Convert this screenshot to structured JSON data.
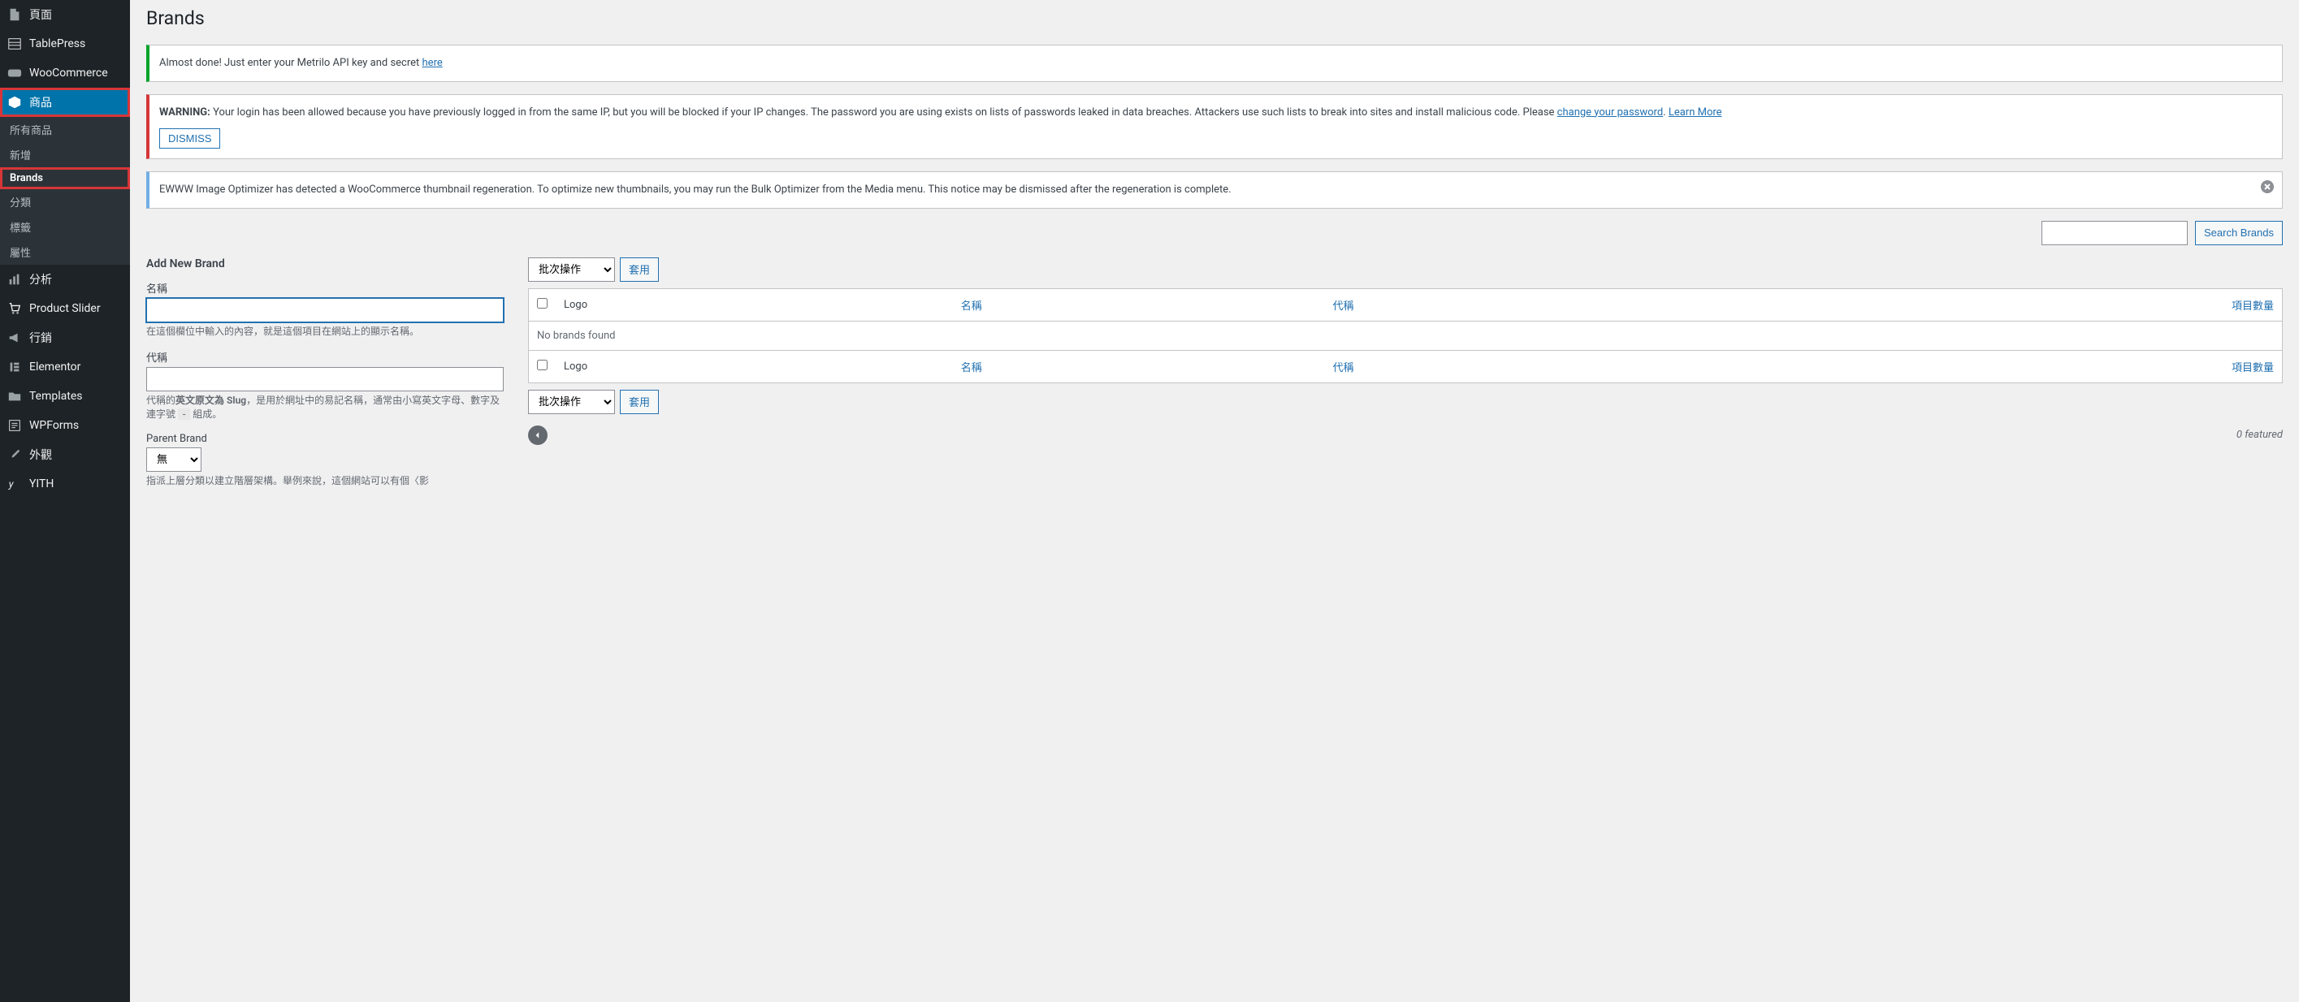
{
  "sidebar": {
    "items": [
      {
        "label": "頁面",
        "icon": "page"
      },
      {
        "label": "TablePress",
        "icon": "table"
      },
      {
        "label": "WooCommerce",
        "icon": "woo"
      },
      {
        "label": "商品",
        "icon": "cube",
        "current": true
      },
      {
        "label": "分析",
        "icon": "chart"
      },
      {
        "label": "Product Slider",
        "icon": "cart"
      },
      {
        "label": "行銷",
        "icon": "megaphone"
      },
      {
        "label": "Elementor",
        "icon": "e"
      },
      {
        "label": "Templates",
        "icon": "folder"
      },
      {
        "label": "WPForms",
        "icon": "form"
      },
      {
        "label": "外觀",
        "icon": "brush"
      },
      {
        "label": "YITH",
        "icon": "y"
      }
    ],
    "submenu": [
      "所有商品",
      "新增",
      "Brands",
      "分類",
      "標籤",
      "屬性"
    ]
  },
  "heading": "Brands",
  "notices": {
    "metrilo_pre": "Almost done! Just enter your Metrilo API key and secret ",
    "metrilo_link": "here",
    "warn_prefix": "WARNING:",
    "warn_body1": " Your login has been allowed because you have previously logged in from the same IP, but you will be blocked if your IP changes. The password you are using exists on lists of passwords leaked in data breaches. Attackers use such lists to break into sites and install malicious code. Please ",
    "warn_link1": "change your password",
    "warn_dot": ". ",
    "warn_link2": "Learn More",
    "dismiss": "DISMISS",
    "ewww": "EWWW Image Optimizer has detected a WooCommerce thumbnail regeneration. To optimize new thumbnails, you may run the Bulk Optimizer from the Media menu. This notice may be dismissed after the regeneration is complete."
  },
  "search": {
    "button": "Search Brands"
  },
  "form": {
    "title": "Add New Brand",
    "name_label": "名稱",
    "name_help": "在這個欄位中輸入的內容，就是這個項目在網站上的顯示名稱。",
    "slug_label": "代稱",
    "slug_help_1": "代稱的",
    "slug_help_bold": "英文原文為 Slug",
    "slug_help_2": "，是用於網址中的易記名稱，通常由小寫英文字母、數字及連字號 ",
    "slug_help_code": "-",
    "slug_help_3": " 組成。",
    "parent_label": "Parent Brand",
    "parent_option": "無",
    "parent_help": "指派上層分類以建立階層架構。舉例來說，這個網站可以有個〈影"
  },
  "table": {
    "bulk_action": "批次操作",
    "apply": "套用",
    "cols": {
      "logo": "Logo",
      "name": "名稱",
      "slug": "代稱",
      "count": "項目數量"
    },
    "empty": "No brands found",
    "featured": "0 featured"
  }
}
